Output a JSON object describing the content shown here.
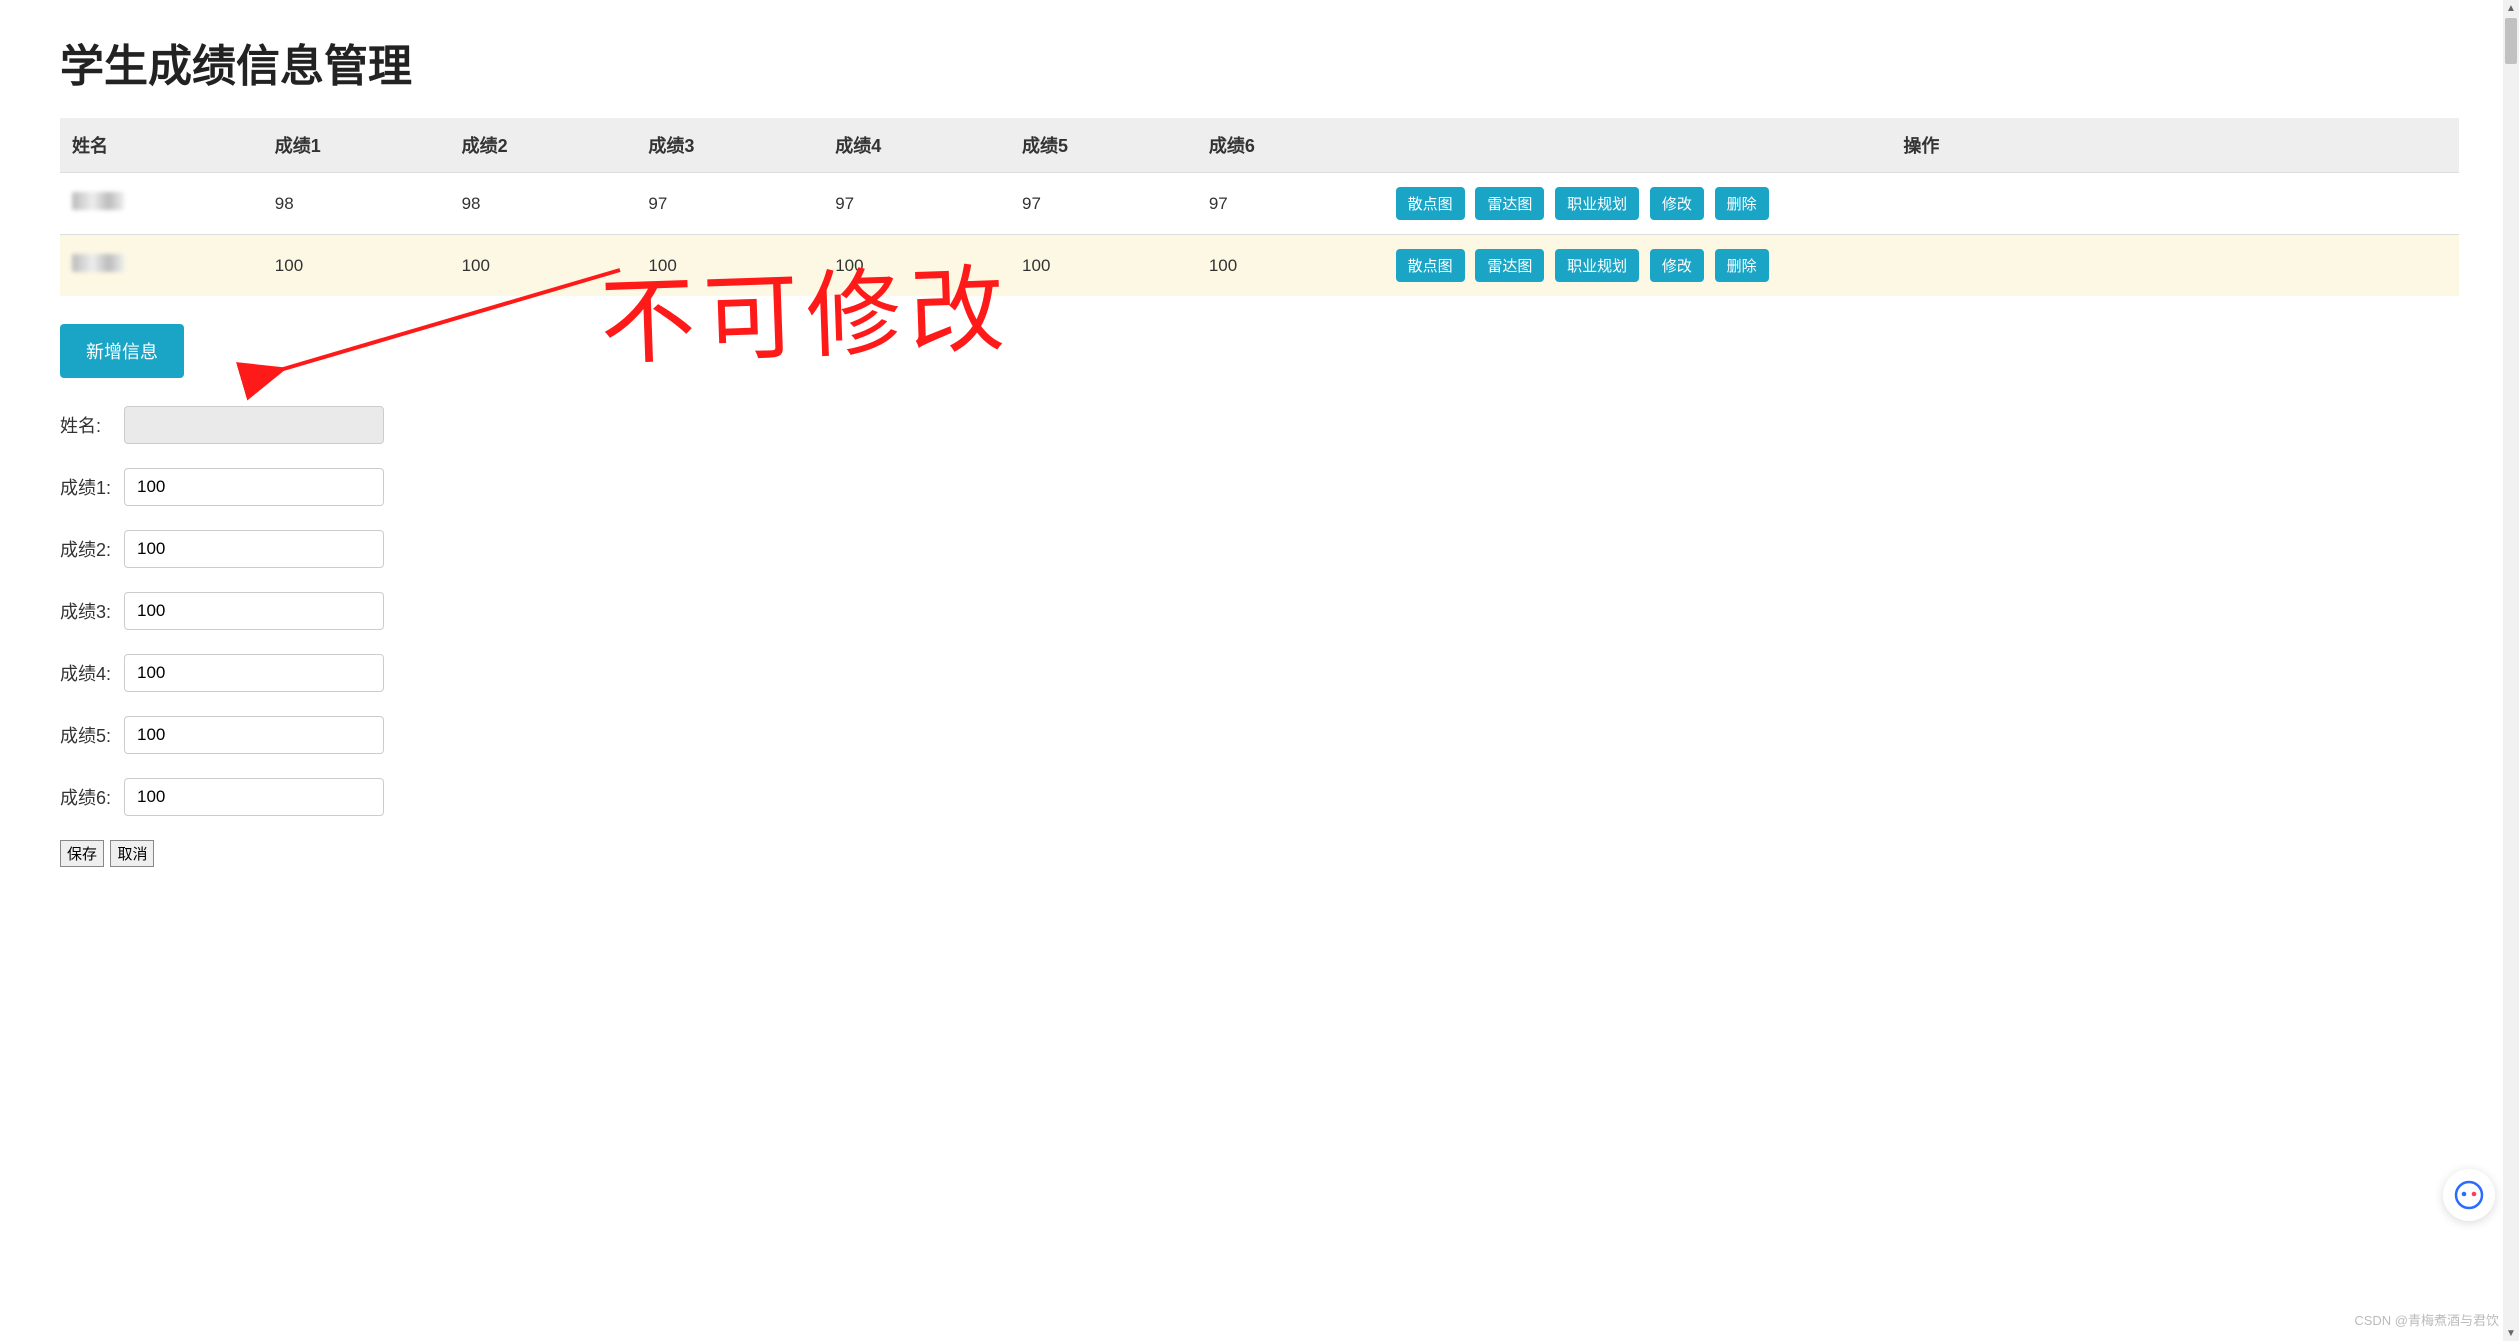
{
  "page_title": "学生成绩信息管理",
  "table": {
    "headers": [
      "姓名",
      "成绩1",
      "成绩2",
      "成绩3",
      "成绩4",
      "成绩5",
      "成绩6",
      "操作"
    ],
    "rows": [
      {
        "name": "",
        "scores": [
          "98",
          "98",
          "97",
          "97",
          "97",
          "97"
        ]
      },
      {
        "name": "",
        "scores": [
          "100",
          "100",
          "100",
          "100",
          "100",
          "100"
        ]
      }
    ],
    "actions": {
      "scatter": "散点图",
      "radar": "雷达图",
      "career": "职业规划",
      "edit": "修改",
      "delete": "删除"
    }
  },
  "add_button": "新增信息",
  "form": {
    "fields": [
      {
        "label": "姓名:",
        "value": "",
        "readonly": true
      },
      {
        "label": "成绩1:",
        "value": "100",
        "readonly": false
      },
      {
        "label": "成绩2:",
        "value": "100",
        "readonly": false
      },
      {
        "label": "成绩3:",
        "value": "100",
        "readonly": false
      },
      {
        "label": "成绩4:",
        "value": "100",
        "readonly": false
      },
      {
        "label": "成绩5:",
        "value": "100",
        "readonly": false
      },
      {
        "label": "成绩6:",
        "value": "100",
        "readonly": false
      }
    ],
    "save": "保存",
    "cancel": "取消"
  },
  "annotation_text": "不可修改",
  "watermark": "CSDN @青梅煮酒与君饮"
}
